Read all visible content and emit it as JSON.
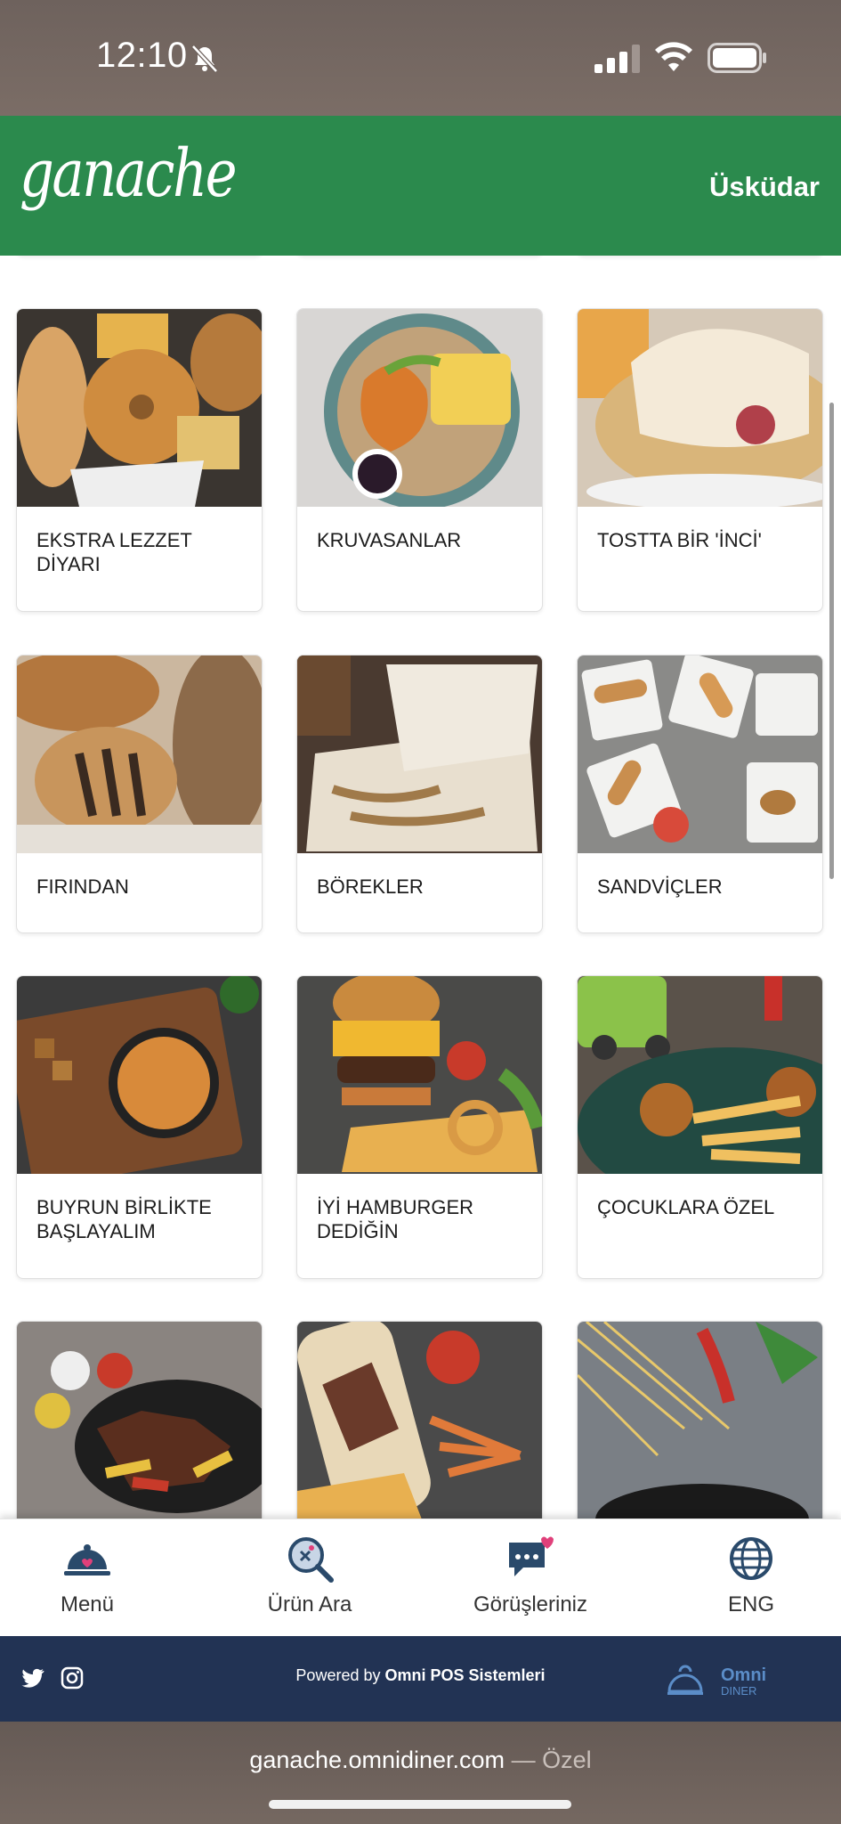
{
  "status_bar": {
    "time": "12:10"
  },
  "header": {
    "logo": "ganache",
    "location": "Üsküdar"
  },
  "categories": [
    {
      "label": "EKSTRA LEZZET DİYARI"
    },
    {
      "label": "KRUVASANLAR"
    },
    {
      "label": "TOSTTA BİR 'İNCİ'"
    },
    {
      "label": "FIRINDAN"
    },
    {
      "label": "BÖREKLER"
    },
    {
      "label": "SANDVİÇLER"
    },
    {
      "label": "BUYRUN BİRLİKTE BAŞLAYALIM"
    },
    {
      "label": "İYİ HAMBURGER DEDİĞİN"
    },
    {
      "label": "ÇOCUKLARA ÖZEL"
    },
    {
      "label": ""
    },
    {
      "label": ""
    },
    {
      "label": ""
    }
  ],
  "bottom_nav": {
    "menu": "Menü",
    "search": "Ürün Ara",
    "feedback": "Görüşleriniz",
    "language": "ENG"
  },
  "footer": {
    "powered_prefix": "Powered by",
    "powered_brand": "Omni POS Sistemleri",
    "omni_logo_line1": "Omni",
    "omni_logo_line2": "DINER"
  },
  "browser": {
    "url": "ganache.omnidiner.com",
    "privacy": "— Özel"
  },
  "colors": {
    "header": "#2b8a4d",
    "footer": "#223354",
    "nav_icon": "#2a4a6b"
  }
}
